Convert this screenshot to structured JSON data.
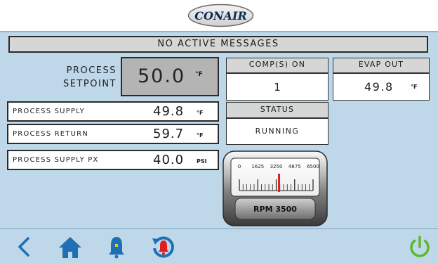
{
  "header": {
    "logo_text": "CONAIR"
  },
  "banner": {
    "message": "NO ACTIVE MESSAGES"
  },
  "setpoint": {
    "label_line1": "PROCESS",
    "label_line2": "SETPOINT",
    "value": "50.0",
    "unit": "°F"
  },
  "rows": [
    {
      "label": "PROCESS SUPPLY",
      "value": "49.8",
      "unit": "°F"
    },
    {
      "label": "PROCESS RETURN",
      "value": "59.7",
      "unit": "°F"
    },
    {
      "label": "PROCESS SUPPLY PX",
      "value": "40.0",
      "unit": "PSI"
    }
  ],
  "comp": {
    "header": "COMP(S) ON",
    "value": "1"
  },
  "evap": {
    "header": "EVAP OUT",
    "value": "49.8",
    "unit": "°F"
  },
  "status": {
    "header": "STATUS",
    "value": "RUNNING"
  },
  "gauge": {
    "ticks": [
      "0",
      "1625",
      "3250",
      "4875",
      "6500"
    ],
    "label": "RPM 3500",
    "rpm": 3500,
    "max": 6500
  },
  "colors": {
    "panel_bg": "#bed8e9",
    "nav_blue": "#1f6fb5",
    "alarm_red": "#e02020",
    "power_green": "#5cb82a"
  },
  "footer": {
    "icons": [
      "back-chevron-icon",
      "home-icon",
      "bell-icon",
      "alarm-history-icon",
      "power-icon"
    ]
  }
}
